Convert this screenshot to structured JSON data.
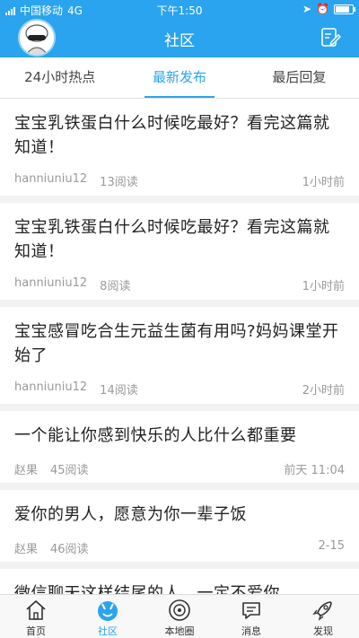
{
  "status_bar": {
    "carrier": "中国移动",
    "network": "4G",
    "time": "下午1:50",
    "battery_level": 0.85
  },
  "header": {
    "title": "社区",
    "avatar_icon": "cartoon-avatar-icon",
    "compose_icon": "edit-icon"
  },
  "tabs": [
    {
      "label": "24小时热点",
      "active": false
    },
    {
      "label": "最新发布",
      "active": true
    },
    {
      "label": "最后回复",
      "active": false
    }
  ],
  "posts": [
    {
      "title": "宝宝乳铁蛋白什么时候吃最好？看完这篇就知道！",
      "author": "hanniuniu12",
      "reads": "13阅读",
      "time": "1小时前"
    },
    {
      "title": "宝宝乳铁蛋白什么时候吃最好？看完这篇就知道！",
      "author": "hanniuniu12",
      "reads": "8阅读",
      "time": "1小时前"
    },
    {
      "title": "宝宝感冒吃合生元益生菌有用吗?妈妈课堂开始了",
      "author": "hanniuniu12",
      "reads": "14阅读",
      "time": "2小时前"
    },
    {
      "title": "一个能让你感到快乐的人比什么都重要",
      "author": "赵果",
      "reads": "45阅读",
      "time": "前天 11:04"
    },
    {
      "title": "爱你的男人，愿意为你一辈子饭",
      "author": "赵果",
      "reads": "46阅读",
      "time": "2-15"
    },
    {
      "title": "微信聊天这样结尾的人，一定不爱你",
      "author": "",
      "reads": "",
      "time": ""
    }
  ],
  "tabbar": [
    {
      "label": "首页",
      "icon": "home-icon",
      "active": false
    },
    {
      "label": "社区",
      "icon": "community-icon",
      "active": true
    },
    {
      "label": "本地圈",
      "icon": "local-circle-icon",
      "active": false
    },
    {
      "label": "消息",
      "icon": "message-icon",
      "active": false
    },
    {
      "label": "发现",
      "icon": "rocket-icon",
      "active": false
    }
  ],
  "colors": {
    "accent": "#2aa4ee",
    "text": "#222222",
    "meta": "#9a9a9a"
  }
}
